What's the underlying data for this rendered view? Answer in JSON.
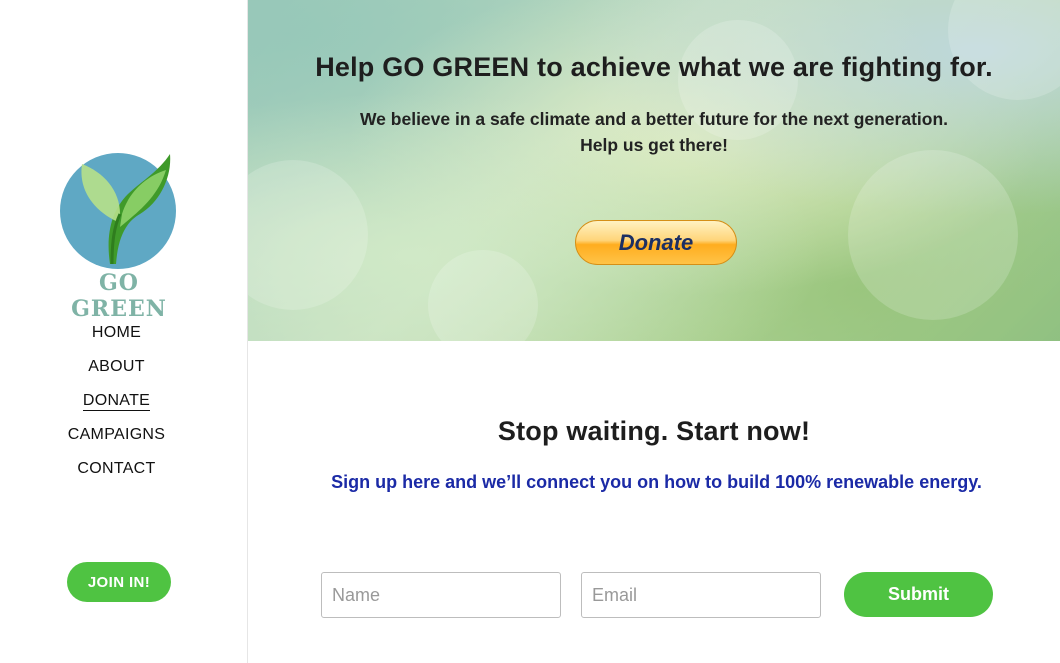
{
  "sidebar": {
    "logo_text": "GO GREEN",
    "nav": [
      {
        "label": "HOME",
        "active": false
      },
      {
        "label": "ABOUT",
        "active": false
      },
      {
        "label": "DONATE",
        "active": true
      },
      {
        "label": "CAMPAIGNS",
        "active": false
      },
      {
        "label": "CONTACT",
        "active": false
      }
    ],
    "join_label": "JOIN IN!"
  },
  "hero": {
    "title": "Help GO GREEN to achieve what we are fighting for.",
    "subtitle_line1": "We believe in a safe climate and a better future for the next generation.",
    "subtitle_line2": "Help us get there!",
    "donate_label": "Donate"
  },
  "signup": {
    "title": "Stop waiting. Start now!",
    "subtitle": "Sign up here and we’ll connect you on how to build 100% renewable energy.",
    "name_placeholder": "Name",
    "email_placeholder": "Email",
    "submit_label": "Submit"
  },
  "colors": {
    "accent_green": "#4fc342",
    "link_blue": "#1b2aa6",
    "donate_gold": "#ffad1f",
    "logo_circle": "#5fa8c4"
  }
}
